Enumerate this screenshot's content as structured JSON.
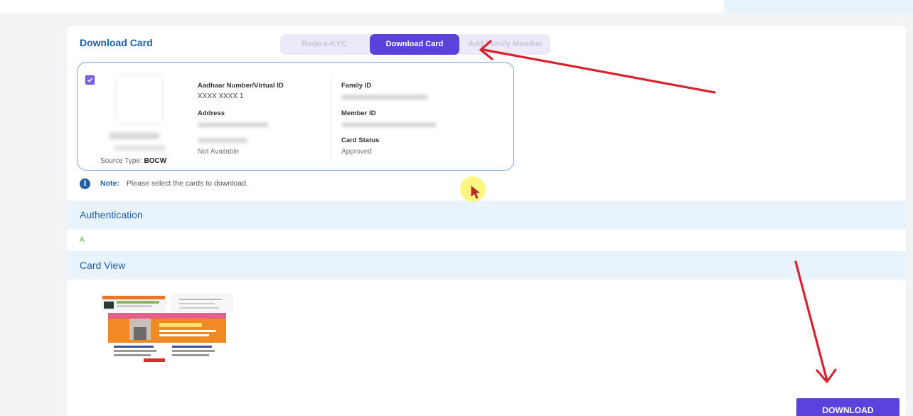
{
  "panel": {
    "title": "Download Card"
  },
  "tabs": [
    {
      "label": "Redo e-KYC",
      "active": false
    },
    {
      "label": "Download Card",
      "active": true
    },
    {
      "label": "Add Family Member",
      "active": false
    }
  ],
  "card": {
    "selected": true,
    "source_type_label": "Source Type:",
    "source_type_value": "BOCW",
    "fields": {
      "aadhaar_label": "Aadhaar Number/Virtual ID",
      "aadhaar_value": "XXXX XXXX 1",
      "address_label": "Address",
      "availability_value": "Not Available",
      "family_id_label": "Family ID",
      "member_id_label": "Member ID",
      "card_status_label": "Card Status",
      "card_status_value": "Approved"
    }
  },
  "note": {
    "label": "Note:",
    "text": "Please select the cards to download."
  },
  "sections": {
    "authentication": "Authentication",
    "authentication_text": "A",
    "card_view": "Card View"
  },
  "download_button": "DOWNLOAD",
  "colors": {
    "accent": "#5a43dc",
    "title_blue": "#1f5fa8",
    "band_bg": "#e9f3fb",
    "annotation_red": "#d8222e",
    "cursor_highlight": "#fff36a"
  },
  "icons": {
    "info": "info-icon",
    "checkbox": "checkbox-checked-icon",
    "cursor": "mouse-cursor-icon"
  }
}
